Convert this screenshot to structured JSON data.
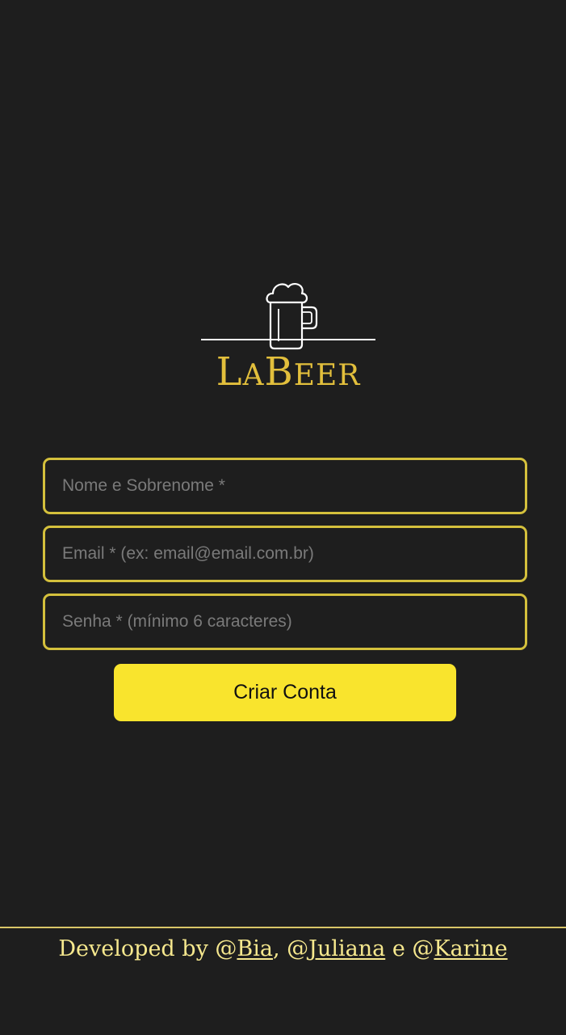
{
  "brand": {
    "logo_icon": "beer-mug-icon",
    "name_first_initial": "L",
    "name_first_rest": "A",
    "name_second_initial": "B",
    "name_second_rest": "EER",
    "accent_color": "#e2bf3c"
  },
  "form": {
    "name_placeholder": "Nome e Sobrenome *",
    "email_placeholder": "Email * (ex: email@email.com.br)",
    "password_placeholder": "Senha * (mínimo 6 caracteres)",
    "submit_label": "Criar Conta",
    "border_color": "#d4c03c",
    "button_color": "#f9e42d"
  },
  "footer": {
    "prefix": "Developed by @",
    "dev1": "Bia",
    "sep1": ", @",
    "dev2": "Juliana",
    "sep2": " e @",
    "dev3": "Karine",
    "text_color": "#f6e88e"
  }
}
